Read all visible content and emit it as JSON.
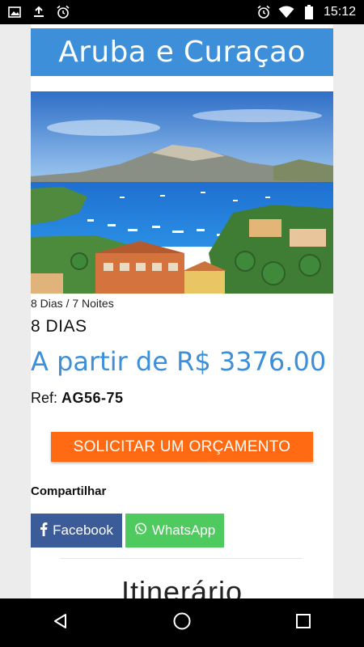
{
  "status_bar": {
    "time": "15:12",
    "left_icons": [
      "image-icon",
      "download-icon",
      "alarm-icon"
    ],
    "right_icons": [
      "alarm-icon",
      "wifi-icon",
      "battery-icon"
    ]
  },
  "page": {
    "title": "Aruba e Curaçao",
    "image_alt": "Aruba e Curaçao harbor view",
    "duration_small": "8 Dias / 7 Noites",
    "duration_big": "8 DIAS",
    "price": "A partir de R$ 3376.00",
    "ref_label": "Ref: ",
    "ref_value": "AG56-75",
    "cta_label": "SOLICITAR UM ORÇAMENTO",
    "share_label": "Compartilhar",
    "share_buttons": {
      "facebook": "Facebook",
      "whatsapp": "WhatsApp"
    },
    "section_title": "Itinerário"
  },
  "colors": {
    "title_bar": "#3d8fd9",
    "price": "#3d8fd9",
    "cta": "#ff6a13",
    "facebook": "#3b5b99",
    "whatsapp": "#4fca5e"
  },
  "nav_bar": {
    "buttons": [
      "back-icon",
      "home-icon",
      "recents-icon"
    ]
  }
}
